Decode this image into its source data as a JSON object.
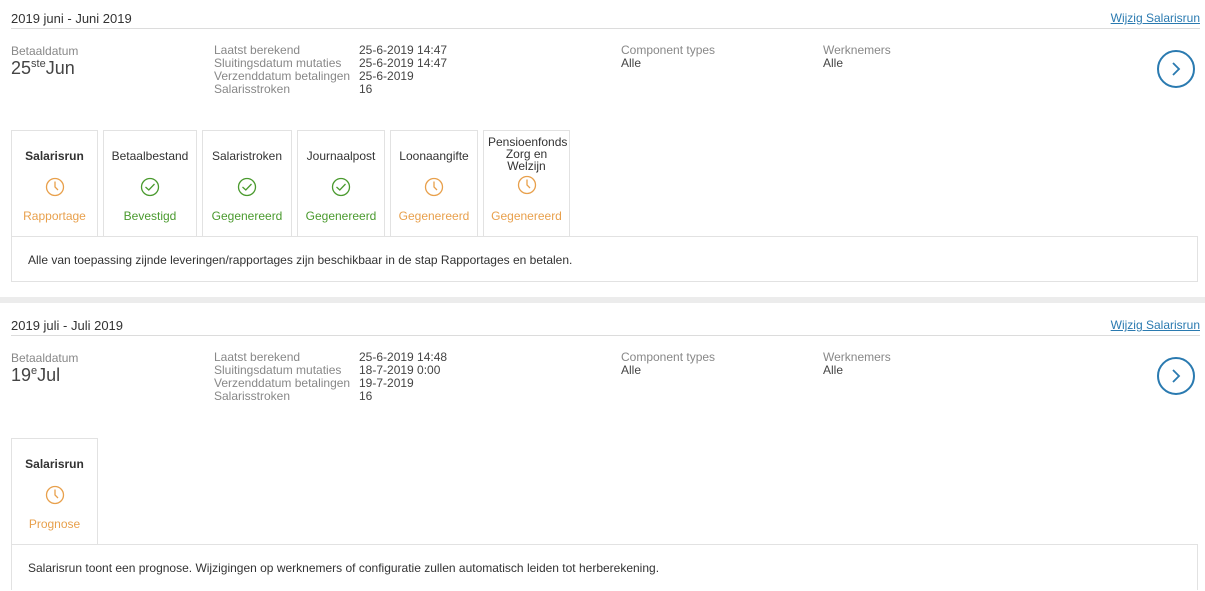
{
  "runs": [
    {
      "title": "2019 juni - Juni 2019",
      "edit_link": "Wijzig Salarisrun",
      "pay_date_label": "Betaaldatum",
      "pay_day": "25",
      "pay_day_suffix": "ste",
      "pay_month": "Jun",
      "details": [
        {
          "label": "Laatst berekend",
          "value": "25-6-2019 14:47"
        },
        {
          "label": "Sluitingsdatum mutaties",
          "value": "25-6-2019 14:47"
        },
        {
          "label": "Verzenddatum betalingen",
          "value": "25-6-2019"
        },
        {
          "label": "Salarisstroken",
          "value": "16"
        }
      ],
      "component_types_label": "Component types",
      "component_types_value": "Alle",
      "employees_label": "Werknemers",
      "employees_value": "Alle",
      "steps": [
        {
          "name": "Salarisrun",
          "status": "Rapportage",
          "icon": "clock-icon",
          "state": "pending"
        },
        {
          "name": "Betaalbestand",
          "status": "Bevestigd",
          "icon": "check-circle-icon",
          "state": "done"
        },
        {
          "name": "Salaristroken",
          "status": "Gegenereerd",
          "icon": "check-circle-icon",
          "state": "done"
        },
        {
          "name": "Journaalpost",
          "status": "Gegenereerd",
          "icon": "check-circle-icon",
          "state": "done"
        },
        {
          "name": "Loonaangifte",
          "status": "Gegenereerd",
          "icon": "clock-icon",
          "state": "pending"
        },
        {
          "name": "Pensioenfonds Zorg en Welzijn",
          "status": "Gegenereerd",
          "icon": "clock-icon",
          "state": "pending"
        }
      ],
      "message": "Alle van toepassing zijnde leveringen/rapportages zijn beschikbaar in de stap Rapportages en betalen."
    },
    {
      "title": "2019 juli - Juli 2019",
      "edit_link": "Wijzig Salarisrun",
      "pay_date_label": "Betaaldatum",
      "pay_day": "19",
      "pay_day_suffix": "e",
      "pay_month": "Jul",
      "details": [
        {
          "label": "Laatst berekend",
          "value": "25-6-2019 14:48"
        },
        {
          "label": "Sluitingsdatum mutaties",
          "value": "18-7-2019 0:00"
        },
        {
          "label": "Verzenddatum betalingen",
          "value": "19-7-2019"
        },
        {
          "label": "Salarisstroken",
          "value": "16"
        }
      ],
      "component_types_label": "Component types",
      "component_types_value": "Alle",
      "employees_label": "Werknemers",
      "employees_value": "Alle",
      "steps": [
        {
          "name": "Salarisrun",
          "status": "Prognose",
          "icon": "clock-icon",
          "state": "pending"
        }
      ],
      "message": "Salarisrun toont een prognose. Wijzigingen op werknemers of configuratie zullen automatisch leiden tot herberekening."
    }
  ],
  "colors": {
    "accent": "#2a7ab0",
    "pending": "#e8a04c",
    "done": "#4a9a2e"
  }
}
